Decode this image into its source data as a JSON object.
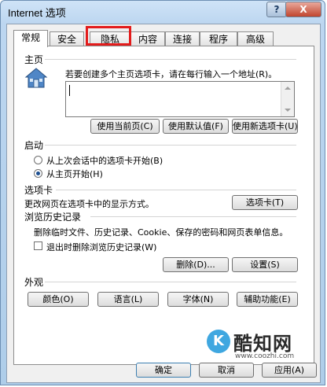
{
  "window": {
    "title": "Internet 选项",
    "help_label": "?",
    "close_label": "X"
  },
  "tabs": [
    {
      "label": "常规",
      "active": true
    },
    {
      "label": "安全",
      "active": false
    },
    {
      "label": "隐私",
      "active": false
    },
    {
      "label": "内容",
      "active": false
    },
    {
      "label": "连接",
      "active": false
    },
    {
      "label": "程序",
      "active": false
    },
    {
      "label": "高级",
      "active": false
    }
  ],
  "homepage": {
    "section_title": "主页",
    "description": "若要创建多个主页选项卡，请在每行输入一个地址(R)。",
    "url_value": "",
    "btn_current": "使用当前页(C)",
    "btn_default": "使用默认值(F)",
    "btn_blank": "使用新选项卡(U)"
  },
  "startup": {
    "section_title": "启动",
    "option_last": "从上次会话中的选项卡开始(B)",
    "option_home": "从主页开始(H)",
    "selected": "option_home"
  },
  "tabs_section": {
    "section_title": "选项卡",
    "description": "更改网页在选项卡中的显示方式。",
    "btn_tabs": "选项卡(T)"
  },
  "history": {
    "section_title": "浏览历史记录",
    "description": "删除临时文件、历史记录、Cookie、保存的密码和网页表单信息。",
    "checkbox_label": "退出时删除浏览历史记录(W)",
    "checkbox_checked": false,
    "btn_delete": "删除(D)...",
    "btn_settings": "设置(S)"
  },
  "appearance": {
    "section_title": "外观",
    "btn_colors": "颜色(O)",
    "btn_languages": "语言(L)",
    "btn_fonts": "字体(N)",
    "btn_accessibility": "辅助功能(E)"
  },
  "footer": {
    "btn_ok": "确定",
    "btn_cancel": "取消",
    "btn_apply": "应用(A)"
  },
  "watermark": {
    "logo_letter": "K",
    "name": "酷知网",
    "url": "www.coozhi.com"
  },
  "colors": {
    "highlight": "#e31b1b",
    "title_gradient_top": "#cfe3f7",
    "close_red": "#c1452f"
  }
}
